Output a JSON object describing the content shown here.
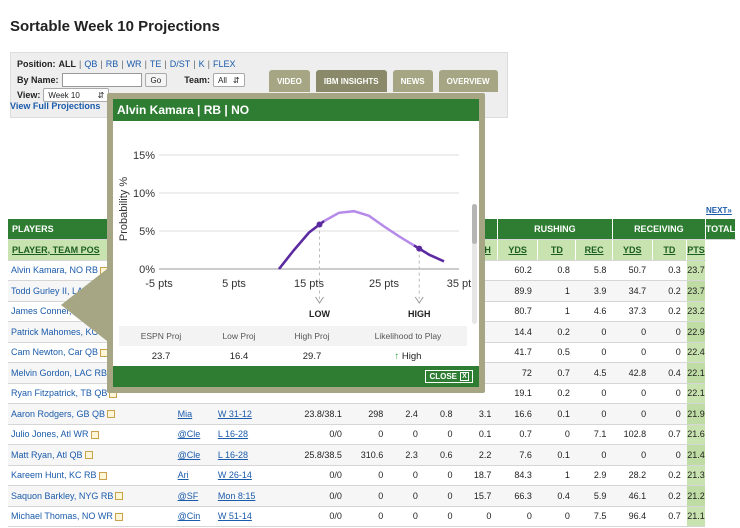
{
  "page_title": "Sortable Week 10 Projections",
  "filters": {
    "position_label": "Position:",
    "positions": [
      "ALL",
      "QB",
      "RB",
      "WR",
      "TE",
      "D/ST",
      "K",
      "FLEX"
    ],
    "by_name_label": "By Name:",
    "go_label": "Go",
    "team_label": "Team:",
    "team_value": "All",
    "view_label": "View:",
    "view_value": "Week 10",
    "full_link": "View Full Projections"
  },
  "tabs": [
    "VIDEO",
    "IBM INSIGHTS",
    "NEWS",
    "OVERVIEW"
  ],
  "next_link": "NEXT»",
  "table": {
    "group_headers": {
      "players": "PLAYERS",
      "rushing": "RUSHING",
      "receiving": "RECEIVING",
      "total": "TOTAL"
    },
    "col_headers": {
      "player": "PLAYER, TEAM POS",
      "rush_h": "H",
      "rush_yds": "YDS",
      "rush_td": "TD",
      "rec": "REC",
      "rec_yds": "YDS",
      "rec_td": "TD",
      "pts": "PTS"
    },
    "rows": [
      {
        "player": "Alvin Kamara, NO RB",
        "opp": "",
        "status": "",
        "catt": "",
        "pyds": "",
        "ptd": "",
        "int": "",
        "car": "",
        "ryds": "60.2",
        "rtd": "0.8",
        "rec": "5.8",
        "recyds": "50.7",
        "rectd": "0.3",
        "pts": "23.7"
      },
      {
        "player": "Todd Gurley II, LAR RB",
        "opp": "",
        "status": "",
        "catt": "",
        "pyds": "",
        "ptd": "",
        "int": "",
        "car": "",
        "ryds": "89.9",
        "rtd": "1",
        "rec": "3.9",
        "recyds": "34.7",
        "rectd": "0.2",
        "pts": "23.7"
      },
      {
        "player": "James Conner, Pit RB",
        "opp": "",
        "status": "",
        "catt": "",
        "pyds": "",
        "ptd": "",
        "int": "",
        "car": "",
        "ryds": "80.7",
        "rtd": "1",
        "rec": "4.6",
        "recyds": "37.3",
        "rectd": "0.2",
        "pts": "23.2"
      },
      {
        "player": "Patrick Mahomes, KC QB",
        "opp": "",
        "status": "",
        "catt": "",
        "pyds": "",
        "ptd": "",
        "int": "",
        "car": "",
        "ryds": "14.4",
        "rtd": "0.2",
        "rec": "0",
        "recyds": "0",
        "rectd": "0",
        "pts": "22.9"
      },
      {
        "player": "Cam Newton, Car QB",
        "opp": "",
        "status": "",
        "catt": "",
        "pyds": "",
        "ptd": "",
        "int": "",
        "car": "",
        "ryds": "41.7",
        "rtd": "0.5",
        "rec": "0",
        "recyds": "0",
        "rectd": "0",
        "pts": "22.4"
      },
      {
        "player": "Melvin Gordon, LAC RB",
        "opp": "",
        "status": "",
        "catt": "",
        "pyds": "",
        "ptd": "",
        "int": "",
        "car": "",
        "ryds": "72",
        "rtd": "0.7",
        "rec": "4.5",
        "recyds": "42.8",
        "rectd": "0.4",
        "pts": "22.1"
      },
      {
        "player": "Ryan Fitzpatrick, TB QB",
        "opp": "",
        "status": "",
        "catt": "",
        "pyds": "",
        "ptd": "",
        "int": "",
        "car": "",
        "ryds": "19.1",
        "rtd": "0.2",
        "rec": "0",
        "recyds": "0",
        "rectd": "0",
        "pts": "22.1"
      },
      {
        "player": "Aaron Rodgers, GB QB",
        "opp": "Mia",
        "status": "W 31-12",
        "catt": "23.8/38.1",
        "pyds": "298",
        "ptd": "2.4",
        "int": "0.8",
        "car": "3.1",
        "ryds": "16.6",
        "rtd": "0.1",
        "rec": "0",
        "recyds": "0",
        "rectd": "0",
        "pts": "21.9"
      },
      {
        "player": "Julio Jones, Atl WR",
        "opp": "@Cle",
        "status": "L 16-28",
        "catt": "0/0",
        "pyds": "0",
        "ptd": "0",
        "int": "0",
        "car": "0.1",
        "ryds": "0.7",
        "rtd": "0",
        "rec": "7.1",
        "recyds": "102.8",
        "rectd": "0.7",
        "pts": "21.6"
      },
      {
        "player": "Matt Ryan, Atl QB",
        "opp": "@Cle",
        "status": "L 16-28",
        "catt": "25.8/38.5",
        "pyds": "310.6",
        "ptd": "2.3",
        "int": "0.6",
        "car": "2.2",
        "ryds": "7.6",
        "rtd": "0.1",
        "rec": "0",
        "recyds": "0",
        "rectd": "0",
        "pts": "21.4"
      },
      {
        "player": "Kareem Hunt, KC RB",
        "opp": "Ari",
        "status": "W 26-14",
        "catt": "0/0",
        "pyds": "0",
        "ptd": "0",
        "int": "0",
        "car": "18.7",
        "ryds": "84.3",
        "rtd": "1",
        "rec": "2.9",
        "recyds": "28.2",
        "rectd": "0.2",
        "pts": "21.3"
      },
      {
        "player": "Saquon Barkley, NYG RB",
        "opp": "@SF",
        "status": "Mon 8:15",
        "catt": "0/0",
        "pyds": "0",
        "ptd": "0",
        "int": "0",
        "car": "15.7",
        "ryds": "66.3",
        "rtd": "0.4",
        "rec": "5.9",
        "recyds": "46.1",
        "rectd": "0.2",
        "pts": "21.2"
      },
      {
        "player": "Michael Thomas, NO WR",
        "opp": "@Cin",
        "status": "W 51-14",
        "catt": "0/0",
        "pyds": "0",
        "ptd": "0",
        "int": "0",
        "car": "0",
        "ryds": "0",
        "rtd": "0",
        "rec": "7.5",
        "recyds": "96.4",
        "rectd": "0.7",
        "pts": "21.1"
      }
    ]
  },
  "popup": {
    "title": "Alvin Kamara  |  RB  |  NO",
    "chart": {
      "ylabel": "Probability %",
      "yticks": [
        "15%",
        "10%",
        "5%",
        "0%"
      ],
      "xticks": [
        "-5 pts",
        "5 pts",
        "15 pts",
        "25 pts",
        "35 pt"
      ],
      "low_label": "LOW",
      "high_label": "HIGH"
    },
    "stats_headers": [
      "ESPN Proj",
      "Low Proj",
      "High Proj",
      "Likelihood to Play"
    ],
    "stats_values": [
      "23.7",
      "16.4",
      "29.7",
      "High"
    ],
    "close_label": "CLOSE",
    "colors": {
      "curve_dark": "#5b2aa0",
      "curve_light": "#b68ae8",
      "header": "#2e7d32"
    }
  },
  "chart_data": {
    "type": "line",
    "title": "",
    "xlabel": "",
    "ylabel": "Probability %",
    "xlim": [
      -5,
      35
    ],
    "ylim": [
      0,
      15
    ],
    "x": [
      11,
      13,
      15,
      17,
      19,
      21,
      23,
      25,
      27,
      29,
      31,
      33
    ],
    "y": [
      0,
      2.5,
      4.8,
      6.3,
      7.4,
      7.6,
      7.0,
      5.6,
      4.3,
      3.1,
      1.9,
      1.0
    ],
    "markers": [
      {
        "label": "LOW",
        "x": 16.4
      },
      {
        "label": "HIGH",
        "x": 29.7
      }
    ]
  }
}
